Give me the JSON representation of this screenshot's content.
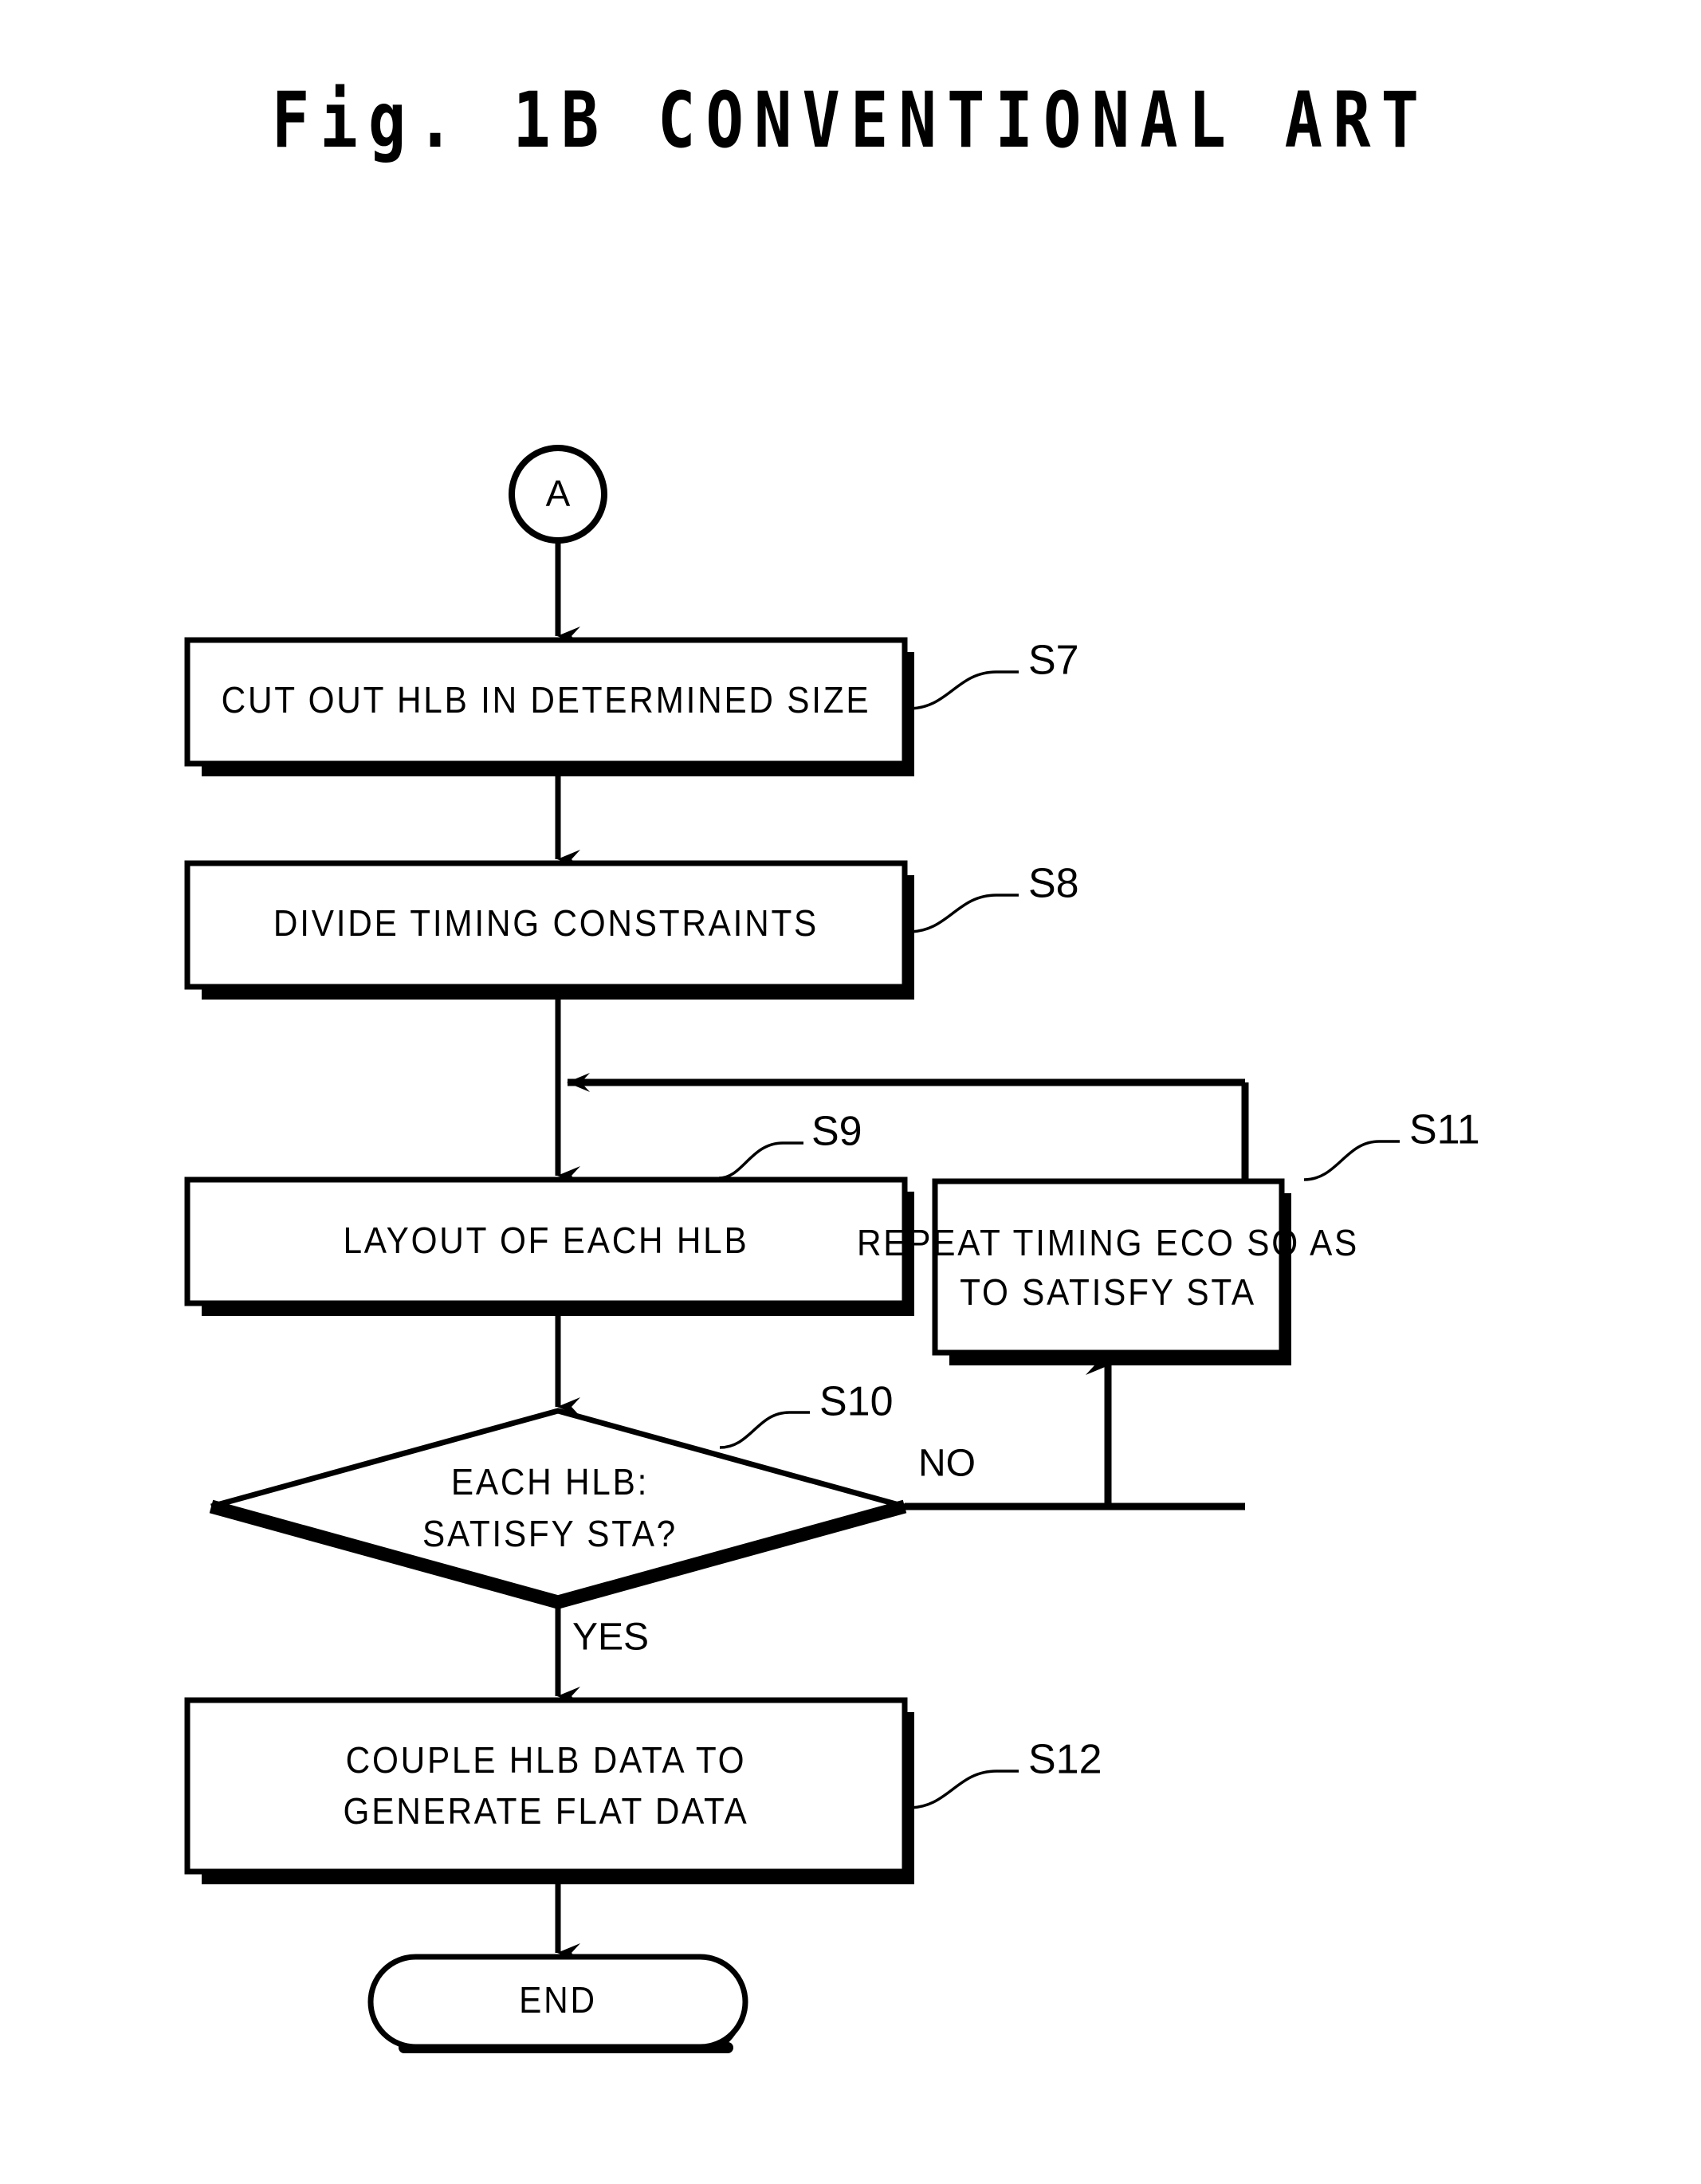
{
  "figure": {
    "title": "Fig. 1B CONVENTIONAL ART"
  },
  "flowchart": {
    "type": "flowchart",
    "connector_in": {
      "name": "connector-a",
      "shape": "circle",
      "label": "A"
    },
    "nodes": [
      {
        "id": "S7",
        "shape": "process",
        "step_label": "S7",
        "lines": [
          "CUT OUT HLB IN DETERMINED SIZE"
        ]
      },
      {
        "id": "S8",
        "shape": "process",
        "step_label": "S8",
        "lines": [
          "DIVIDE TIMING CONSTRAINTS"
        ]
      },
      {
        "id": "S9",
        "shape": "process",
        "step_label": "S9",
        "lines": [
          "LAYOUT OF EACH HLB"
        ]
      },
      {
        "id": "S10",
        "shape": "decision",
        "step_label": "S10",
        "lines": [
          "EACH HLB:",
          "SATISFY STA?"
        ]
      },
      {
        "id": "S11",
        "shape": "process",
        "step_label": "S11",
        "lines": [
          "REPEAT TIMING ECO SO AS",
          "TO SATISFY STA"
        ]
      },
      {
        "id": "S12",
        "shape": "process",
        "step_label": "S12",
        "lines": [
          "COUPLE HLB DATA TO",
          "GENERATE FLAT DATA"
        ]
      }
    ],
    "terminator": {
      "name": "end-terminator",
      "shape": "stadium",
      "label": "END"
    },
    "branch_labels": {
      "no": "NO",
      "yes": "YES"
    },
    "colors": {
      "ink": "#000000",
      "paper": "#ffffff"
    }
  }
}
